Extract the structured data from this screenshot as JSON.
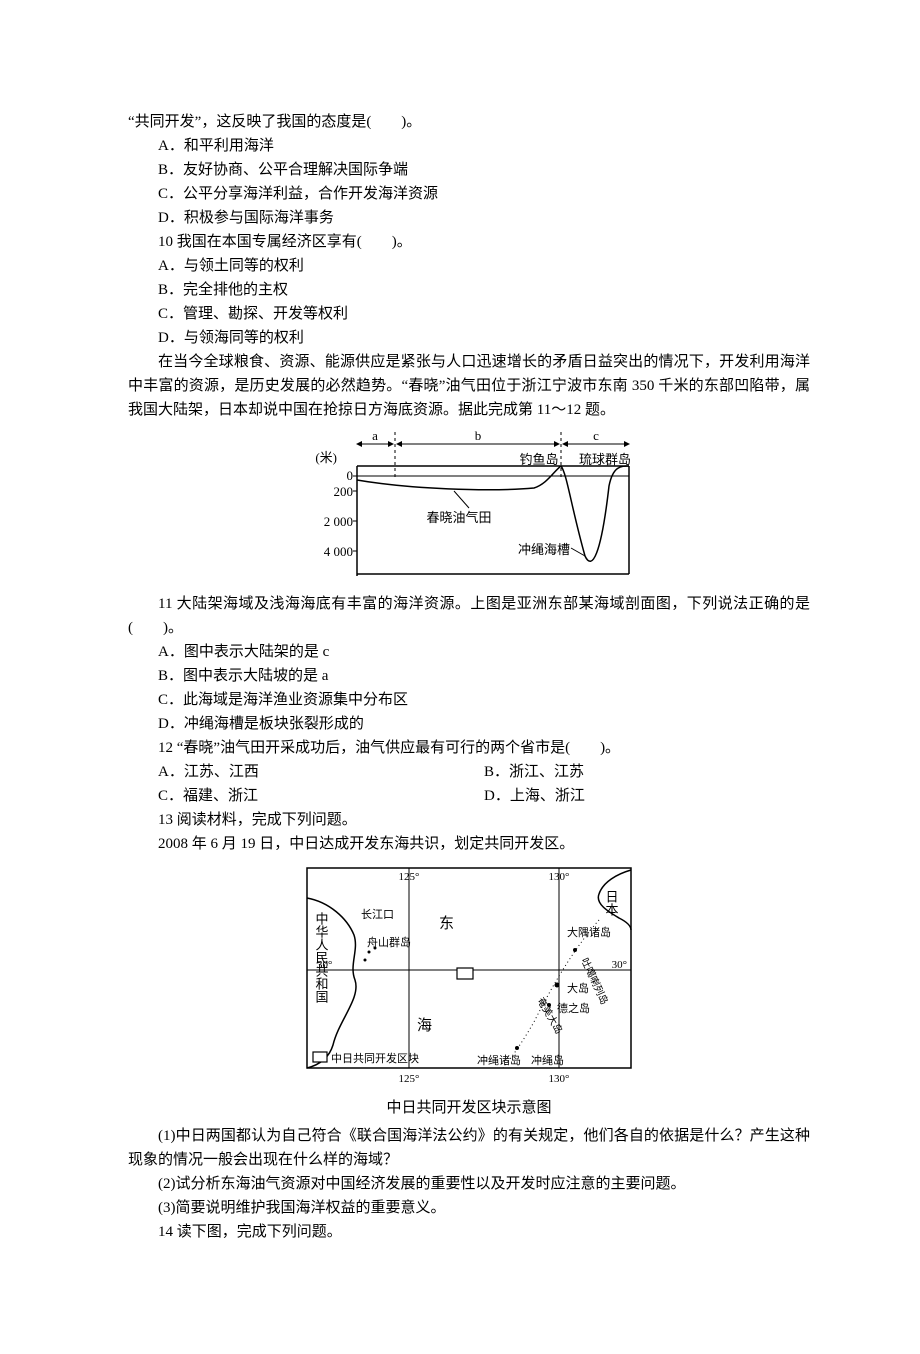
{
  "q9": {
    "stem_cont": "“共同开发”，这反映了我国的态度是(　　)。",
    "A": "A．和平利用海洋",
    "B": "B．友好协商、公平合理解决国际争端",
    "C": "C．公平分享海洋利益，合作开发海洋资源",
    "D": "D．积极参与国际海洋事务"
  },
  "q10": {
    "stem": "10 我国在本国专属经济区享有(　　)。",
    "A": "A．与领土同等的权利",
    "B": "B．完全排他的主权",
    "C": "C．管理、勘探、开发等权利",
    "D": "D．与领海同等的权利"
  },
  "passage11": {
    "p1": "在当今全球粮食、资源、能源供应是紧张与人口迅速增长的矛盾日益突出的情况下，开发利用海洋中丰富的资源，是历史发展的必然趋势。“春晓”油气田位于浙江宁波市东南 350 千米的东部凹陷带，属我国大陆架，日本却说中国在抢掠日方海底资源。据此完成第 11～12 题。"
  },
  "fig11": {
    "seg_a": "a",
    "seg_b": "b",
    "seg_c": "c",
    "yunit": "(米)",
    "y0": "0",
    "y1": "200",
    "y2": "2 000",
    "y3": "4 000",
    "label_diaoyu": "钓鱼岛",
    "label_ryukyu": "琉球群岛",
    "label_chunxiao": "春晓油气田",
    "label_trough": "冲绳海槽"
  },
  "q11": {
    "stem": "11 大陆架海域及浅海海底有丰富的海洋资源。上图是亚洲东部某海域剖面图，下列说法正确的是(　　)。",
    "A": "A．图中表示大陆架的是 c",
    "B": "B．图中表示大陆坡的是 a",
    "C": "C．此海域是海洋渔业资源集中分布区",
    "D": "D．冲绳海槽是板块张裂形成的"
  },
  "q12": {
    "stem": "12 “春晓”油气田开采成功后，油气供应最有可行的两个省市是(　　)。",
    "A": "A．江苏、江西",
    "B": "B．浙江、江苏",
    "C": "C．福建、浙江",
    "D": "D．上海、浙江"
  },
  "q13": {
    "stem": "13 阅读材料，完成下列问题。",
    "material": "2008 年 6 月 19 日，中日达成开发东海共识，划定共同开发区。"
  },
  "fig13": {
    "lon125": "125°",
    "lon130": "130°",
    "lat30": "30°",
    "china": "中华人民共和国",
    "japan": "日本",
    "yangtze": "长江口",
    "zhoushan": "舟山群岛",
    "east": "东",
    "sea": "海",
    "osumi": "大隅诸岛",
    "tukara": "吐噶喇列岛",
    "amami": "奄美大岛",
    "oshima": "大岛",
    "tokuno": "德之岛",
    "okinawa_islands": "冲绳诸岛",
    "okinawa": "冲绳岛",
    "legend": "中日共同开发区块",
    "caption": "中日共同开发区块示意图"
  },
  "q13sub": {
    "s1": "(1)中日两国都认为自己符合《联合国海洋法公约》的有关规定，他们各自的依据是什么？产生这种现象的情况一般会出现在什么样的海域？",
    "s2": "(2)试分析东海油气资源对中国经济发展的重要性以及开发时应注意的主要问题。",
    "s3": "(3)简要说明维护我国海洋权益的重要意义。"
  },
  "q14": {
    "stem": "14 读下图，完成下列问题。"
  }
}
